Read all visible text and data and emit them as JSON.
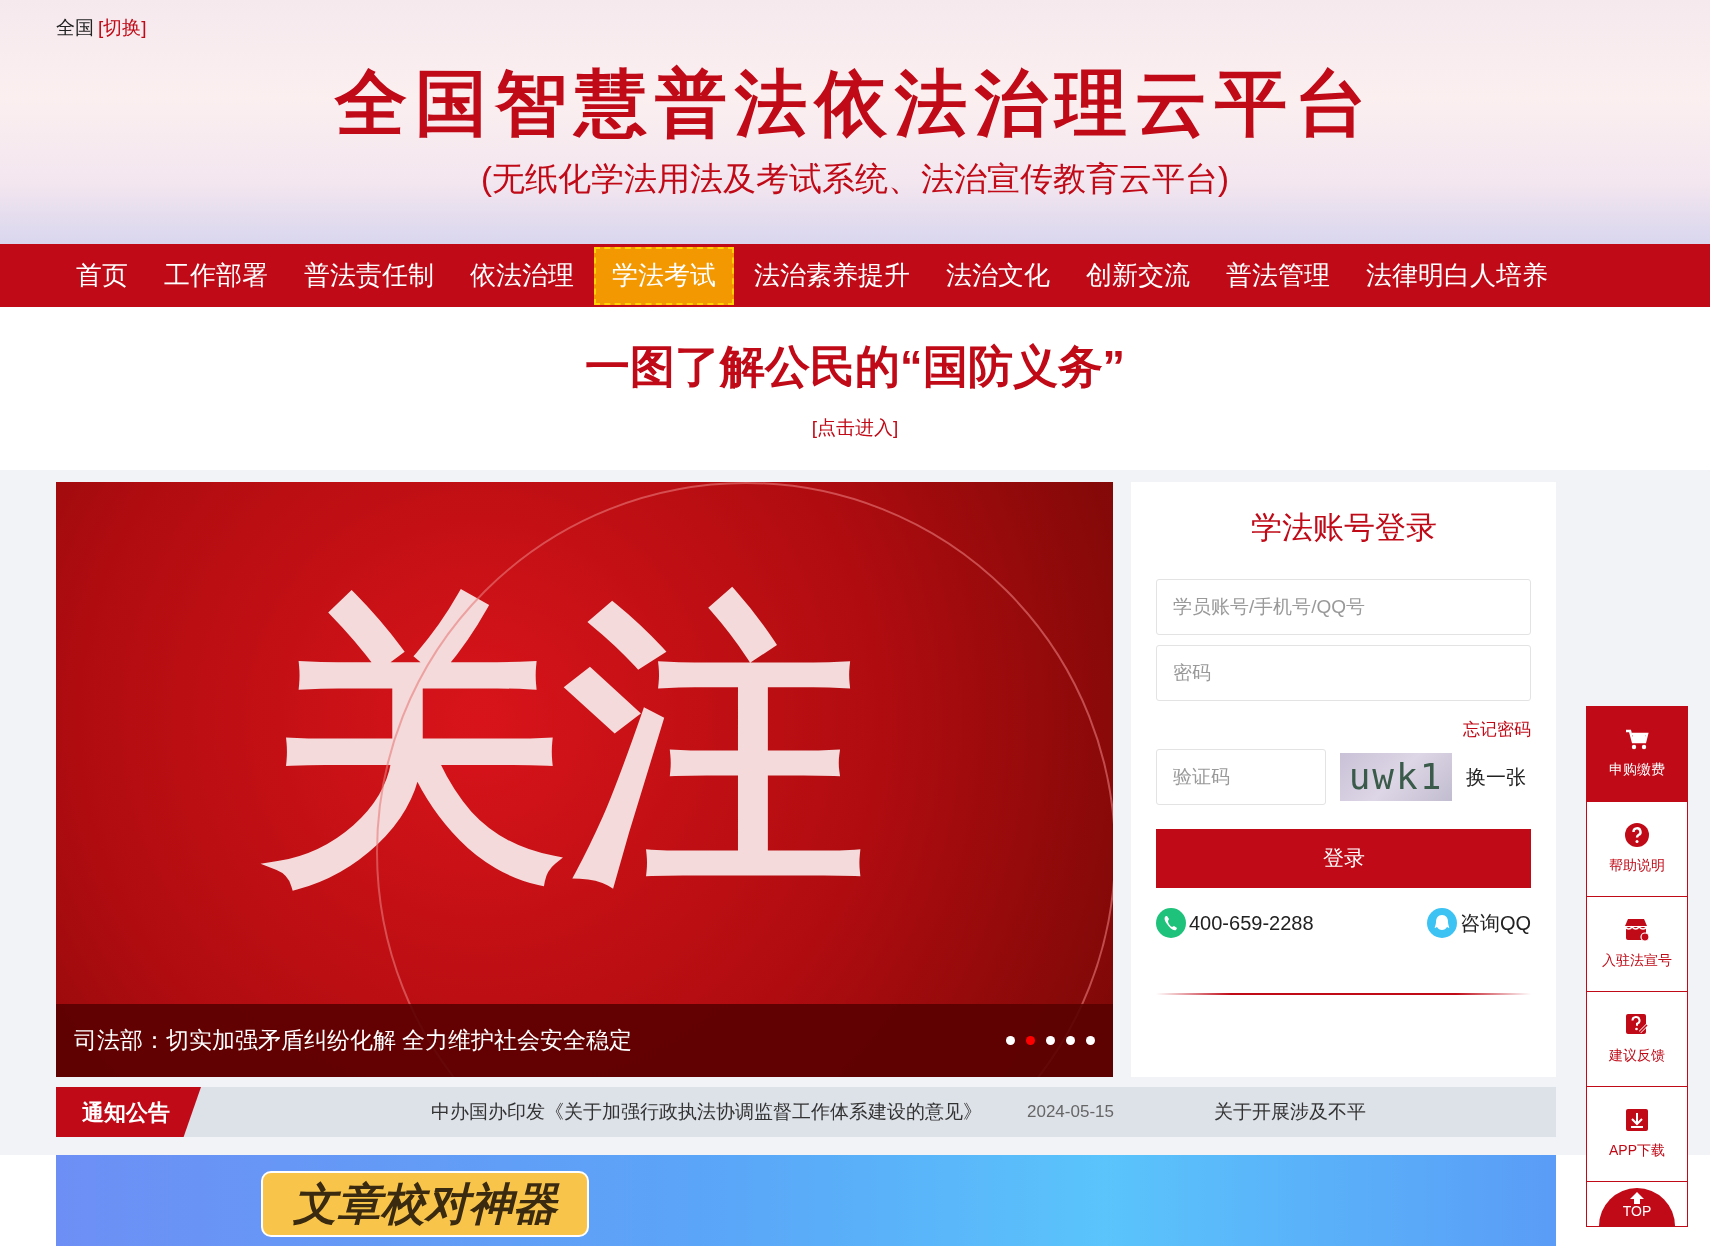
{
  "location": {
    "region": "全国",
    "switch_link": "[切换]"
  },
  "site_title": "全国智慧普法依法治理云平台",
  "site_subtitle": "(无纸化学法用法及考试系统、法治宣传教育云平台)",
  "nav": [
    {
      "label": "首页",
      "selected": false
    },
    {
      "label": "工作部署",
      "selected": false
    },
    {
      "label": "普法责任制",
      "selected": false
    },
    {
      "label": "依法治理",
      "selected": false
    },
    {
      "label": "学法考试",
      "selected": true
    },
    {
      "label": "法治素养提升",
      "selected": false
    },
    {
      "label": "法治文化",
      "selected": false
    },
    {
      "label": "创新交流",
      "selected": false
    },
    {
      "label": "普法管理",
      "selected": false
    },
    {
      "label": "法律明白人培养",
      "selected": false
    }
  ],
  "feature": {
    "headline": "一图了解公民的“国防义务”",
    "link": "[点击进入]"
  },
  "slider": {
    "image_text": "关注",
    "caption": "司法部：切实加强矛盾纠纷化解 全力维护社会安全稳定",
    "dots": [
      {
        "selected": false
      },
      {
        "selected": true
      },
      {
        "selected": false
      },
      {
        "selected": false
      },
      {
        "selected": false
      }
    ]
  },
  "login": {
    "title": "学法账号登录",
    "account_placeholder": "学员账号/手机号/QQ号",
    "password_placeholder": "密码",
    "forgot": "忘记密码",
    "captcha_placeholder": "验证码",
    "captcha_text": "uwk1",
    "refresh": "换一张",
    "submit": "登录",
    "phone": "400-659-2288",
    "qq": "咨询QQ"
  },
  "notice": {
    "label": "通知公告",
    "items": [
      {
        "title": "中办国办印发《关于加强行政执法协调监督工作体系建设的意见》",
        "date": "2024-05-15"
      },
      {
        "title": "关于开展涉及不平"
      }
    ]
  },
  "promo_banner": {
    "text": "文章校对神器"
  },
  "side_tools": [
    {
      "kind": "cart",
      "label": "申购缴费",
      "selected": true
    },
    {
      "kind": "help",
      "label": "帮助说明",
      "selected": false
    },
    {
      "kind": "shop",
      "label": "入驻法宣号",
      "selected": false
    },
    {
      "kind": "feedback",
      "label": "建议反馈",
      "selected": false
    },
    {
      "kind": "download",
      "label": "APP下载",
      "selected": false
    },
    {
      "kind": "top",
      "label": "TOP",
      "selected": false
    }
  ]
}
